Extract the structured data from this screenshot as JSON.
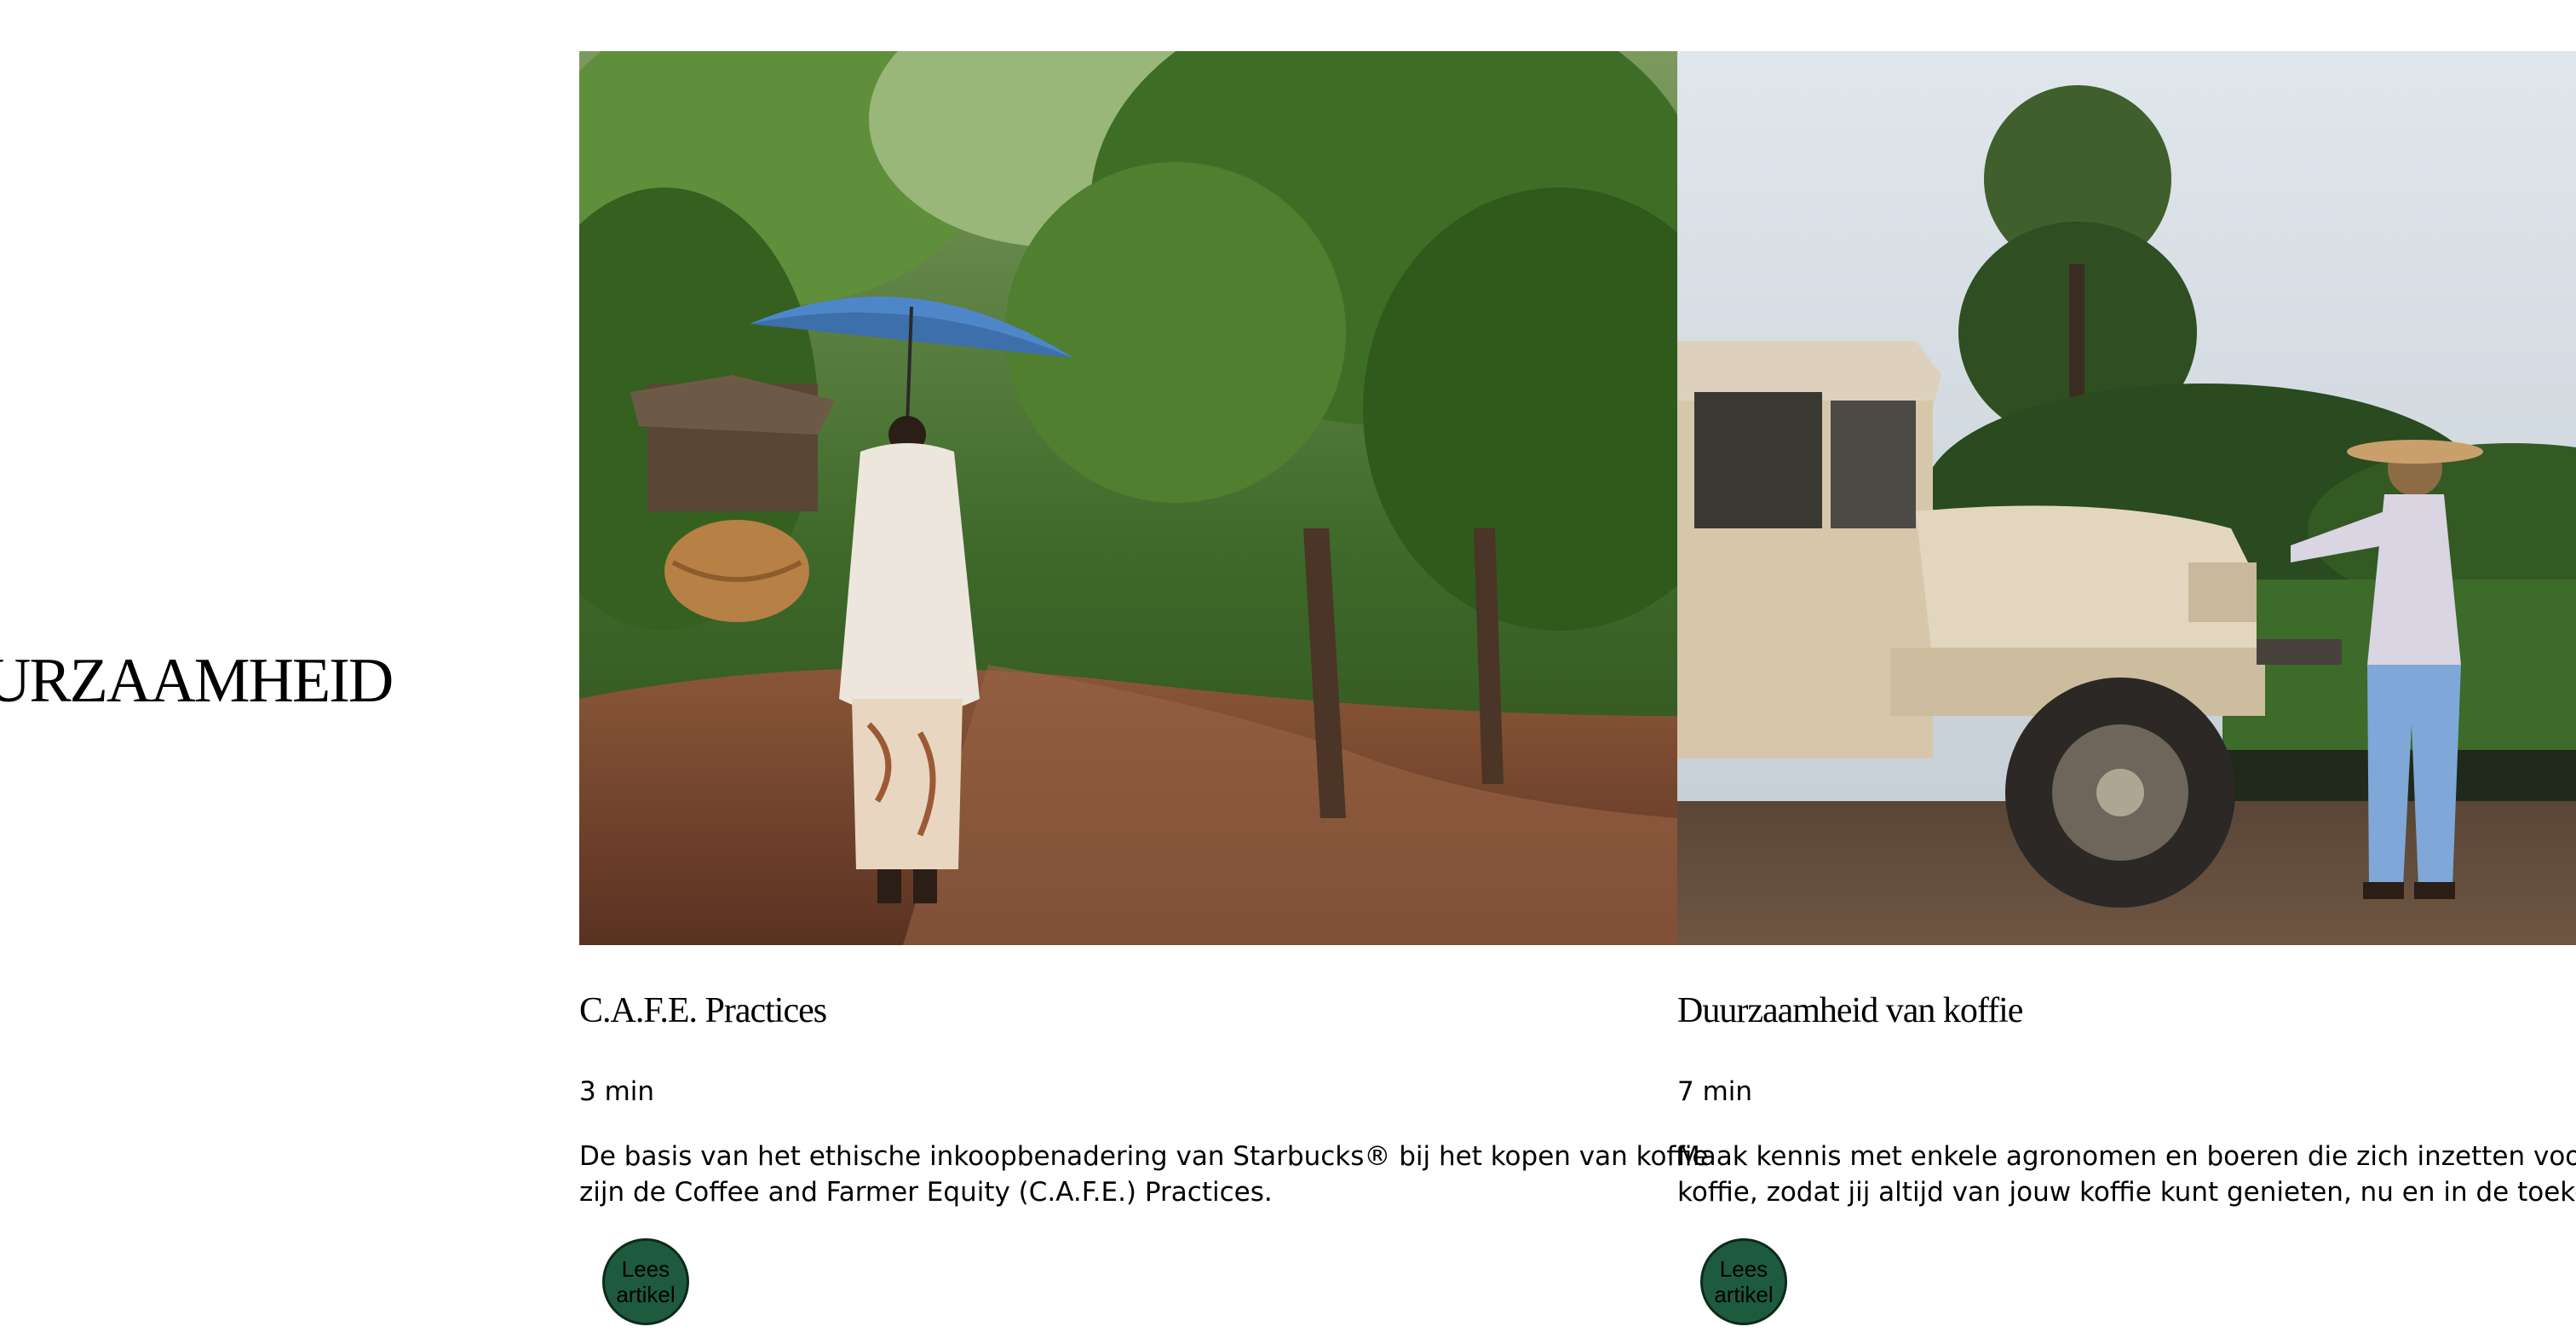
{
  "section": {
    "heading": "DUURZAAMHEID"
  },
  "cards": [
    {
      "image_alt": "Vrouw met paraplu en mand op een pad tussen koffieplanten",
      "title": "C.A.F.E. Practices",
      "read_time": "3 min",
      "description_line1": "De basis van het ethische inkoopbenadering van Starbucks® bij het kopen van koffie",
      "description_line2": "zijn de Coffee and Farmer Equity (C.A.F.E.) Practices.",
      "button_label": "Lees artikel"
    },
    {
      "image_alt": "Boer naast een oude terreinwagen bij een koffieplantage",
      "title": "Duurzaamheid van koffie",
      "read_time": "7 min",
      "description_line1": "Maak kennis met enkele agronomen en boeren die zich inzetten voor de toekomst van",
      "description_line2": "koffie, zodat jij altijd van jouw koffie kunt genieten, nu en in de toekomst.",
      "button_label": "Lees artikel"
    }
  ],
  "colors": {
    "button_green": "#1e5b3e",
    "background": "#ffffff",
    "text": "#000000"
  }
}
